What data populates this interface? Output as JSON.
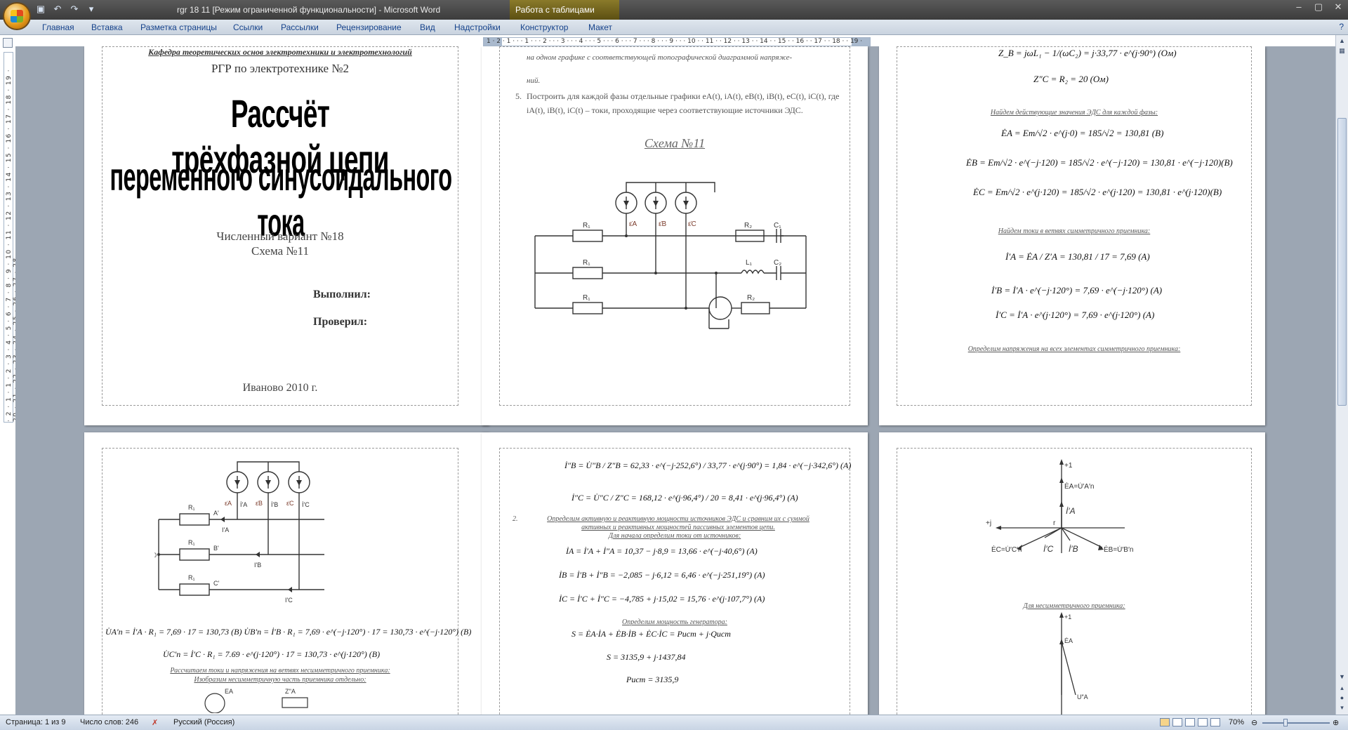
{
  "titlebar": {
    "document_title": "rgr 18 11 [Режим ограниченной функциональности] - Microsoft Word",
    "context_tab_title": "Работа с таблицами",
    "controls": [
      "–",
      "▢",
      "✕"
    ]
  },
  "ribbon": {
    "tabs": [
      "Главная",
      "Вставка",
      "Разметка страницы",
      "Ссылки",
      "Рассылки",
      "Рецензирование",
      "Вид",
      "Надстройки",
      "Конструктор",
      "Макет"
    ]
  },
  "hruler": {
    "ticks": "1 · 2 · 1 · · · 1 · · · 2 · · · 3 · · · 4 · · · 5 · · · 6 · · · 7 · · · 8 · · · 9 · · · 10 · · 11 · · 12 · · 13 · · 14 · · 15 · · 16 · · 17 · · 18 · · 19 ·"
  },
  "vruler": {
    "ticks": "· 2 · 1 · 1 · 2 · 3 · 4 · 5 · 6 · 7 · 8 · 9 · 10 · 11 · 12 · 13 · 14 · 15 · 16 · 17 · 18 · 19 · 20 · 21 · 22 · 23 · 24 · 25 · 26 · 27 · 28"
  },
  "page1": {
    "header": "Кафедра теоретических основ электротехники и электротехнологий",
    "rgr": "РГР по электротехнике №2",
    "title_line1": "Рассчёт трёхфазной цепи",
    "title_line2": "переменного синусоидального тока",
    "variant": "Численный вариант №18",
    "scheme": "Схема №11",
    "done_by": "Выполнил:",
    "checked_by": "Проверил:",
    "city_year": "Иваново 2010 г."
  },
  "page2": {
    "line_a": "на одном графике с соответствующей топографической диаграммой напряже-",
    "line_b": "ний.",
    "item5_num": "5.",
    "item5_text": "Построить для каждой фазы отдельные графики eA(t), iA(t), eB(t), iB(t), eC(t), iC(t), где",
    "item5_text2": "iA(t), iB(t), iC(t) – токи, проходящие через соответствующие источники ЭДС.",
    "scheme_title": "Схема №11",
    "labels": {
      "R1": "R₁",
      "R2": "R₂",
      "C1": "C₁",
      "C2": "C₂",
      "L1": "L₁",
      "eA": "ε̇A",
      "eB": "ε̇B",
      "eC": "ε̇C"
    }
  },
  "page3": {
    "f_zb": "Z_B = jωL₁ − 1/(ωC₂) = j·33,77 · e^(j·90°) (Ом)",
    "f_zc": "Z″C = R₂ = 20 (Ом)",
    "h_emf": "Найдем действующие значения ЭДС для каждой фазы:",
    "f_ea": "ĖA = Em/√2 · e^(j·0) = 185/√2 = 130,81 (В)",
    "f_eb": "ĖB = Em/√2 · e^(−j·120) = 185/√2 · e^(−j·120) = 130,81 · e^(−j·120)(В)",
    "f_ec": "ĖC = Em/√2 · e^(j·120) = 185/√2 · e^(j·120) = 130,81 · e^(j·120)(В)",
    "h_currents": "Найдем токи в ветвях симметричного приемника:",
    "f_ia": "İ′A = ĖA / Z′A = 130,81 / 17 = 7,69 (А)",
    "f_ib": "İ′B = İ′A · e^(−j·120°) = 7,69 · e^(−j·120°) (А)",
    "f_ic": "İ′C = İ′A · e^(j·120°) = 7,69 · e^(j·120°) (А)",
    "h_voltages": "Определим напряжения на всех элементах симметричного приемника:"
  },
  "page4": {
    "labels": {
      "R1": "R₁",
      "eA": "ε̇A",
      "eB": "ε̇B",
      "eC": "ε̇C",
      "A": "A'",
      "B": "B'",
      "C": "C'",
      "IA": "İ'A",
      "IB": "İ'B",
      "IC": "İ'C",
      "N": "0",
      "Iap": "I'A",
      "Ibp": "I'B",
      "Icp": "I'C",
      "EA": "EA",
      "ZA": "Z''A"
    },
    "f_uan": "U̇A′n = İ′A · R₁ = 7,69 · 17 = 130,73 (В) U̇B′n = İ′B · R₁ = 7,69 · e^(−j·120°) · 17 = 130,73 · e^(−j·120°) (В)",
    "f_ucn": "U̇C′n = İ′C · R₁ = 7.69 · e^(j·120°) · 17 = 130,73 · e^(j·120°) (В)",
    "h1": "Рассчитаем токи и напряжения на ветвях несимметричного приемника:",
    "h2": "Изобразим несимметричную часть приемника отдельно:"
  },
  "page5": {
    "f_ib2": "İ″B = U̇″B / Z″B = 62,33 · e^(−j·252,6°) / 33,77 · e^(j·90°) = 1,84 · e^(−j·342,6°) (А)",
    "f_ic2": "İ″C = U̇″C / Z″C = 168,12 · e^(j·96,4°) / 20 = 8,41 · e^(j·96,4°) (А)",
    "item2_num": "2.",
    "item2_text": "Определим активную и реактивную мощности источников ЭДС и сравним их с суммой",
    "item2_text2": "активных и реактивных мощностей пассивных элементов цепи.",
    "h_src": "Для начала определим токи от источников:",
    "f_ia": "İA = İ′A + İ″A = 10,37 − j·8,9 = 13,66 · e^(−j·40,6°) (А)",
    "f_ib": "İB = İ′B + İ″B = −2,085 − j·6,12 = 6,46 · e^(−j·251,19°) (А)",
    "f_ic": "İC = İ′C + İ″C = −4,785 + j·15,02 = 15,76 · e^(j·107,7°) (А)",
    "h_gen": "Определим мощность генератора:",
    "f_s": "S = ĖA·İA + ĖB·İB + ĖC·İC = Pист + j·Qист",
    "f_s2": "S = 3135,9 + j·1437,84",
    "f_p": "Pист = 3135,9"
  },
  "page6": {
    "axis_plus1": "+1",
    "axis_plusj": "+j",
    "origin": "r",
    "ea_label": "ĖA=U̇′A′n",
    "ia_label": "İ′A",
    "ec_label": "ĖC=U̇′C′n",
    "ic_label": "İ′C",
    "ib_label": "İ′B",
    "eb_label": "ĖB=U̇′B′n",
    "h_asym": "Для несимметричного приемника:",
    "axis_plus1_b": "+1",
    "ea_label_b": "ĖA",
    "ua_label_b": "U″A"
  },
  "statusbar": {
    "page": "Страница: 1 из 9",
    "words": "Число слов: 246",
    "lang": "Русский (Россия)",
    "zoom": "70%"
  },
  "colors": {
    "accent": "#15428b",
    "doc_bg": "#9ca6b3"
  }
}
